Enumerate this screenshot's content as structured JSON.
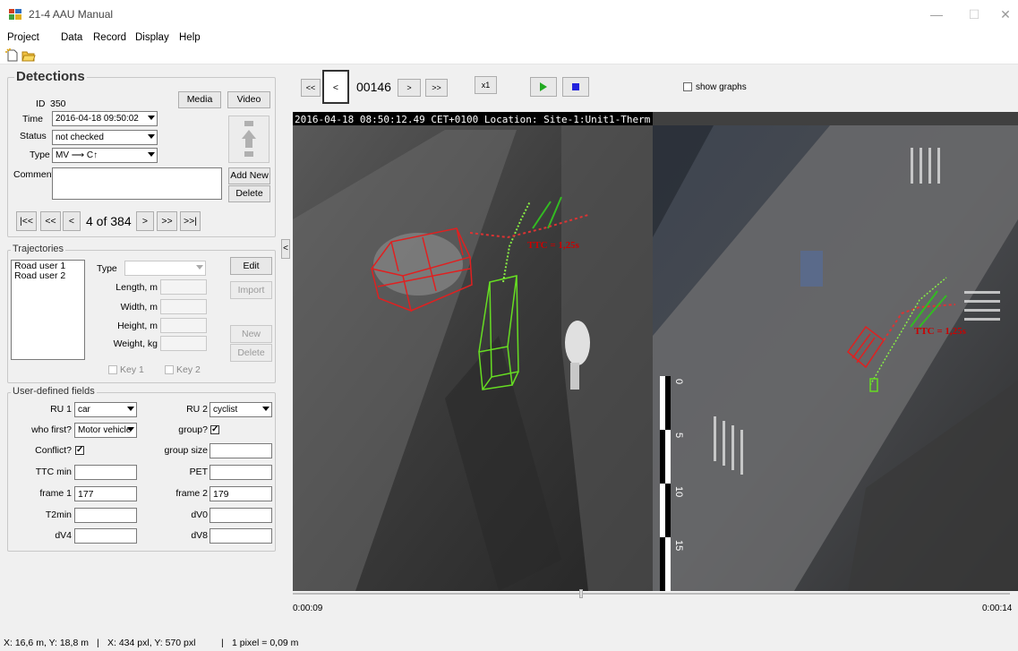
{
  "window": {
    "title": "21-4 AAU Manual",
    "minimize": "—",
    "maximize": "☐",
    "close": "✕"
  },
  "menu": {
    "project": "Project",
    "data": "Data",
    "record": "Record",
    "display": "Display",
    "help": "Help"
  },
  "toolbar": {
    "new_icon": "new-file-icon",
    "open_icon": "open-folder-icon"
  },
  "detections": {
    "title": "Detections",
    "id_label": "ID",
    "id_value": "350",
    "media": "Media",
    "video": "Video",
    "time_label": "Time",
    "time_value": "2016-04-18  09:50:02",
    "status_label": "Status",
    "status_value": "not checked",
    "type_label": "Type",
    "type_value": "MV ⟶  C↑",
    "comment_label": "Comment",
    "comment_value": "",
    "add_new": "Add New",
    "delete": "Delete",
    "nav": {
      "first": "|<<",
      "prev_fast": "<<",
      "prev": "<",
      "position": "4 of 384",
      "next": ">",
      "next_fast": ">>",
      "last": ">>|"
    }
  },
  "trajectories": {
    "title": "Trajectories",
    "items": [
      "Road user 1",
      "Road user 2"
    ],
    "type_label": "Type",
    "edit": "Edit",
    "import": "Import",
    "length_label": "Length, m",
    "width_label": "Width, m",
    "height_label": "Height, m",
    "weight_label": "Weight, kg",
    "new": "New",
    "delete": "Delete",
    "key1": "Key 1",
    "key2": "Key 2"
  },
  "user_fields": {
    "title": "User-defined fields",
    "ru1_label": "RU 1",
    "ru1_value": "car",
    "ru2_label": "RU 2",
    "ru2_value": "cyclist",
    "who_first_label": "who first?",
    "who_first_value": "Motor vehicle",
    "group_label": "group?",
    "group_checked": "✓",
    "conflict_label": "Conflict?",
    "conflict_checked": "✓",
    "group_size_label": "group size",
    "group_size_value": "",
    "ttc_min_label": "TTC min",
    "ttc_min_value": "",
    "pet_label": "PET",
    "pet_value": "",
    "frame1_label": "frame 1",
    "frame1_value": "177",
    "frame2_label": "frame 2",
    "frame2_value": "179",
    "t2min_label": "T2min",
    "t2min_value": "",
    "dv0_label": "dV0",
    "dv0_value": "",
    "dv4_label": "dV4",
    "dv4_value": "",
    "dv8_label": "dV8",
    "dv8_value": ""
  },
  "player": {
    "rewind": "<<",
    "prev": "<",
    "frame": "00146",
    "next": ">",
    "forward": ">>",
    "speed": "x1",
    "play_icon": "play-icon",
    "stop_icon": "stop-icon",
    "show_graphs": "show graphs",
    "collapse": "<"
  },
  "video": {
    "overlay": "2016-04-18 08:50:12.49 CET+0100 Location: Site-1:Unit1-Therm",
    "ttc_left": "TTC = 1,25s",
    "ttc_right": "TTC = 1,25s",
    "scale": [
      "0",
      "5",
      "10",
      "15"
    ]
  },
  "timeline": {
    "start": "0:00:09",
    "end": "0:00:14",
    "position": 0.4
  },
  "status": {
    "world": "X: 16,6 m, Y: 18,8 m",
    "pixel": "X: 434 pxl, Y: 570 pxl",
    "scale": "1 pixel = 0,09 m",
    "sep": "|"
  },
  "colors": {
    "car_box": "#e02020",
    "cyclist_box": "#66dd22",
    "ttc": "#cc0000",
    "play": "#22aa22",
    "stop": "#2222dd"
  }
}
